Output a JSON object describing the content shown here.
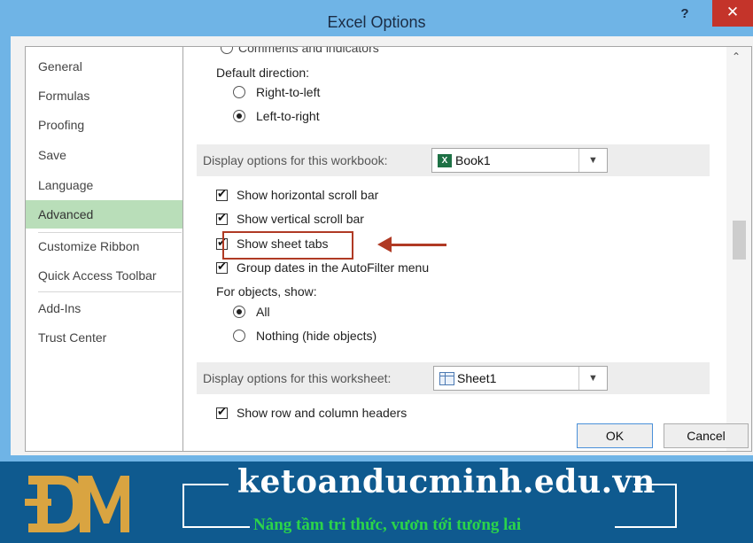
{
  "window": {
    "title": "Excel Options",
    "help_glyph": "?",
    "close_glyph": "✕"
  },
  "nav": {
    "items": [
      {
        "label": "General",
        "active": false
      },
      {
        "label": "Formulas",
        "active": false
      },
      {
        "label": "Proofing",
        "active": false
      },
      {
        "label": "Save",
        "active": false
      },
      {
        "label": "Language",
        "active": false
      },
      {
        "label": "Advanced",
        "active": true
      },
      {
        "label": "Customize Ribbon",
        "active": false
      },
      {
        "label": "Quick Access Toolbar",
        "active": false
      },
      {
        "label": "Add-Ins",
        "active": false
      },
      {
        "label": "Trust Center",
        "active": false
      }
    ]
  },
  "panel": {
    "cut_top_text": "Comments and indicators",
    "default_direction_label": "Default direction:",
    "rtl": {
      "label": "Right-to-left",
      "selected": false
    },
    "ltr": {
      "label": "Left-to-right",
      "selected": true
    },
    "workbook_group": {
      "label": "Display options for this workbook:",
      "selected": "Book1",
      "icon": "excel-workbook-icon"
    },
    "workbook_options": {
      "hscroll": {
        "label": "Show horizontal scroll bar",
        "checked": true
      },
      "vscroll": {
        "label": "Show vertical scroll bar",
        "checked": true
      },
      "sheet_tabs": {
        "label": "Show sheet tabs",
        "checked": true
      },
      "group_dates": {
        "label": "Group dates in the AutoFilter menu",
        "checked": true
      }
    },
    "objects_label": "For objects, show:",
    "objects_all": {
      "label": "All",
      "selected": true
    },
    "objects_nothing": {
      "label": "Nothing (hide objects)",
      "selected": false
    },
    "worksheet_group": {
      "label": "Display options for this worksheet:",
      "selected": "Sheet1",
      "icon": "worksheet-icon"
    },
    "cut_bottom_text": "Show row and column headers"
  },
  "buttons": {
    "ok": "OK",
    "cancel": "Cancel"
  },
  "banner": {
    "site": "ketoanducminh.edu.vn",
    "slogan": "Nâng tầm tri thức, vươn tới tương lai",
    "logo_text": "DM"
  },
  "colors": {
    "title_bar": "#6fb4e6",
    "close_button": "#c4342a",
    "nav_active": "#b9deb9",
    "highlight": "#b03a24",
    "banner_bg": "#0f5a8f",
    "slogan": "#2bd44a",
    "logo_gold": "#d9a441"
  }
}
